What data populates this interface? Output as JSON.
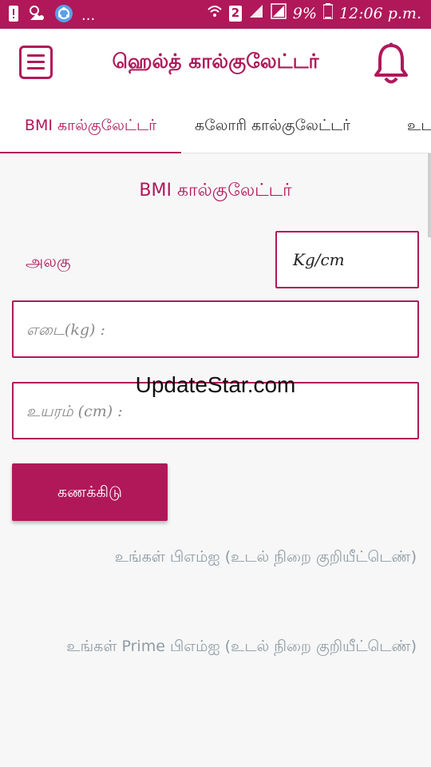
{
  "status_bar": {
    "notification_icons": [
      "warning-icon",
      "app-notification-icon",
      "share-icon"
    ],
    "more": "...",
    "sim_badge": "2",
    "battery_percent": "9%",
    "time": "12:06 p.m."
  },
  "app_bar": {
    "title": "ஹெல்த் கால்குலேட்டர்",
    "menu_icon": "menu-icon",
    "notification_icon": "bell-icon"
  },
  "tabs": [
    {
      "label": "BMI கால்குலேட்டர்",
      "active": true
    },
    {
      "label": "கலோரி கால்குலேட்டர்",
      "active": false
    },
    {
      "label": "உட",
      "active": false
    }
  ],
  "form": {
    "title": "BMI கால்குலேட்டர்",
    "unit_label": "அலகு",
    "unit_value": "Kg/cm",
    "weight_placeholder": "எடை(kg) :",
    "height_placeholder": "உயரம் (cm) :",
    "calculate_label": "கணக்கிடு"
  },
  "results": {
    "bmi_text": "உங்கள் பிஎம்ஐ (உடல் நிறை குறியீட்டெண்)",
    "prime_bmi_text": "உங்கள் Prime பிஎம்ஐ (உடல் நிறை குறியீட்டெண்)"
  },
  "watermark": "UpdateStar.com",
  "colors": {
    "accent": "#b0185a",
    "muted_text": "#8e9ba3"
  }
}
